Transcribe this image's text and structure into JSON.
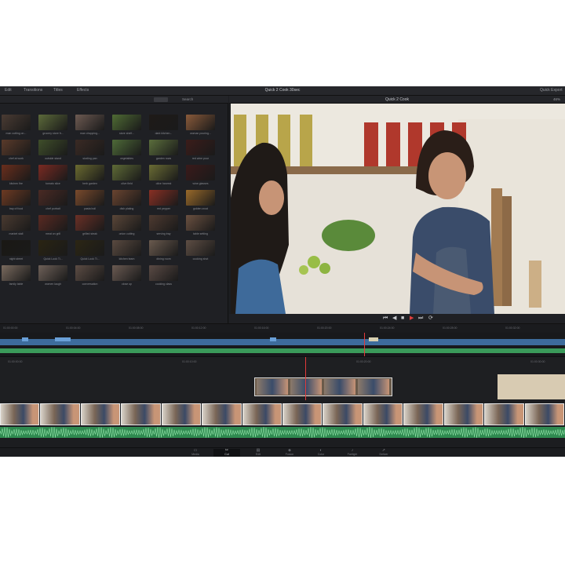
{
  "window": {
    "title": "Quick 2 Cook 30sec",
    "menu": [
      "Edit",
      "Transitions",
      "Titles",
      "Effects"
    ],
    "right_label": "Quick Export"
  },
  "media_pool": {
    "search_label": "Search",
    "clips": [
      {
        "name": "man cutting on...",
        "color": "#4a3b33"
      },
      {
        "name": "grocery store fr...",
        "color": "#5c6a3a"
      },
      {
        "name": "man chopping...",
        "color": "#6d5a52"
      },
      {
        "name": "store shelf...",
        "color": "#4f6b34"
      },
      {
        "name": "dark kitchen...",
        "color": "#1e1a18"
      },
      {
        "name": "woman pouring...",
        "color": "#8a5a3a"
      },
      {
        "name": "chef at work",
        "color": "#5a3a2a"
      },
      {
        "name": "outside stand",
        "color": "#3f4e2a"
      },
      {
        "name": "sizzling pan",
        "color": "#3a2a24"
      },
      {
        "name": "vegetables",
        "color": "#4e6a38"
      },
      {
        "name": "garden rows",
        "color": "#5b6e3c"
      },
      {
        "name": "red wine pour",
        "color": "#3b1c1a"
      },
      {
        "name": "kitchen fire",
        "color": "#6a2e1c"
      },
      {
        "name": "tomato slice",
        "color": "#7a2a22"
      },
      {
        "name": "herb garden",
        "color": "#6a6a30"
      },
      {
        "name": "olive field",
        "color": "#5e6a36"
      },
      {
        "name": "olive harvest",
        "color": "#6a6c34"
      },
      {
        "name": "wine glasses",
        "color": "#3a1a1a"
      },
      {
        "name": "tray of food",
        "color": "#6e3a22"
      },
      {
        "name": "chef portrait",
        "color": "#4a2a24"
      },
      {
        "name": "pasta boil",
        "color": "#7a4a2c"
      },
      {
        "name": "dish plating",
        "color": "#6a4430"
      },
      {
        "name": "red pepper",
        "color": "#8a3024"
      },
      {
        "name": "golden crust",
        "color": "#9a6a2a"
      },
      {
        "name": "market stall",
        "color": "#4a3a30"
      },
      {
        "name": "meat on grill",
        "color": "#5a2a22"
      },
      {
        "name": "grilled steak",
        "color": "#6a3026"
      },
      {
        "name": "onion cutting",
        "color": "#5a4638"
      },
      {
        "name": "serving tray",
        "color": "#4e3a30"
      },
      {
        "name": "table setting",
        "color": "#6a5040"
      },
      {
        "name": "night street",
        "color": "#1a1814"
      },
      {
        "name": "Quick Look Ti...",
        "color": "#2a2412"
      },
      {
        "name": "Quick Look Ti...",
        "color": "#2c2614"
      },
      {
        "name": "kitchen team",
        "color": "#5a4a40"
      },
      {
        "name": "dining room",
        "color": "#6a5a4e"
      },
      {
        "name": "cooking shot",
        "color": "#5e4e44"
      },
      {
        "name": "family table",
        "color": "#7a6a5e"
      },
      {
        "name": "women laugh",
        "color": "#6e6058"
      },
      {
        "name": "conversation",
        "color": "#5c4c44"
      },
      {
        "name": "close up",
        "color": "#6a5a52"
      },
      {
        "name": "cooking class",
        "color": "#5a4a44"
      }
    ]
  },
  "viewer": {
    "clip_name": "Quick 2 Cook",
    "zoom": "46%",
    "shelf_items": [
      "bottle",
      "bottle",
      "bottle",
      "bottle",
      "jar",
      "jar",
      "jar",
      "jar",
      "jar"
    ]
  },
  "transport": {
    "buttons": [
      "skip-back",
      "step-back",
      "stop",
      "play",
      "step-forward",
      "loop"
    ]
  },
  "timeline": {
    "ruler_ticks": [
      "01:00:00:00",
      "01:00:04:00",
      "01:00:08:00",
      "01:00:12:00",
      "01:00:16:00",
      "01:00:20:00",
      "01:00:24:00",
      "01:00:28:00",
      "01:00:32:00"
    ],
    "upper_ticks": [
      "01:00:00:00",
      "01:00:10:00",
      "01:00:20:00",
      "01:00:30:00"
    ],
    "video_clip_count": 14
  },
  "pages": [
    {
      "name": "Media",
      "glyph": "▭"
    },
    {
      "name": "Cut",
      "glyph": "✂"
    },
    {
      "name": "Edit",
      "glyph": "▤"
    },
    {
      "name": "Fusion",
      "glyph": "◈"
    },
    {
      "name": "Color",
      "glyph": "◐"
    },
    {
      "name": "Fairlight",
      "glyph": "♪"
    },
    {
      "name": "Deliver",
      "glyph": "➚"
    }
  ],
  "active_page": "Cut",
  "colors": {
    "accent": "#e23a3a",
    "timeline_blue": "#3d6c9c",
    "audio_green": "#3a9a5a"
  }
}
